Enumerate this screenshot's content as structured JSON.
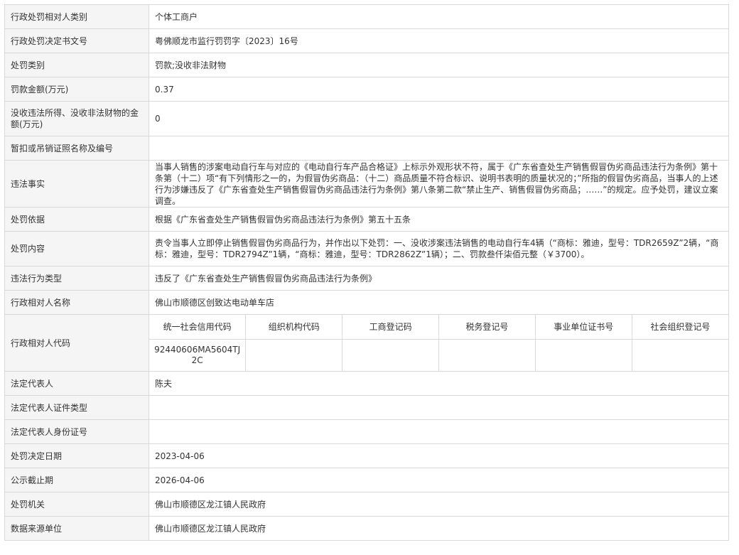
{
  "rows": [
    {
      "label": "行政处罚相对人类别",
      "value": "个体工商户"
    },
    {
      "label": "行政处罚决定书文号",
      "value": "粤佛顺龙市监行罚罚字〔2023〕16号"
    },
    {
      "label": "处罚类别",
      "value": "罚款;没收非法财物"
    },
    {
      "label": "罚款金额(万元)",
      "value": "0.37"
    },
    {
      "label": "没收违法所得、没收非法财物的金额(万元)",
      "value": "0"
    },
    {
      "label": "暂扣或吊销证照名称及编号",
      "value": ""
    },
    {
      "label": "违法事实",
      "value": "当事人销售的涉案电动自行车与对应的《电动自行车产品合格证》上标示外观形状不符，属于《广东省查处生产销售假冒伪劣商品违法行为条例》第十条第（十二）项“有下列情形之一的，为假冒伪劣商品：（十二）商品质量不符合标识、说明书表明的质量状况的；”所指的假冒伪劣商品，当事人的上述行为涉嫌违反了《广东省查处生产销售假冒伪劣商品违法行为条例》第八条第二款“禁止生产、销售假冒伪劣商品；……”的规定。应予处罚，建议立案调查。"
    },
    {
      "label": "处罚依据",
      "value": "根据《广东省查处生产销售假冒伪劣商品违法行为条例》第五十五条"
    },
    {
      "label": "处罚内容",
      "value": "责令当事人立即停止销售假冒伪劣商品行为，并作出以下处罚：一、没收涉案违法销售的电动自行车4辆（“商标：雅迪，型号：TDR2659Z”2辆，“商标：雅迪，型号：TDR2794Z”1辆，“商标：雅迪，型号：TDR2862Z”1辆）；二、罚款叁仟柒佰元整（￥3700）。"
    },
    {
      "label": "违法行为类型",
      "value": "违反了《广东省查处生产销售假冒伪劣商品违法行为条例》"
    },
    {
      "label": "行政相对人名称",
      "value": "佛山市顺德区创致达电动单车店"
    }
  ],
  "codes": {
    "label": "行政相对人代码",
    "headers": [
      "统一社会信用代码",
      "组织机构代码",
      "工商登记码",
      "税务登记号",
      "事业单位证书号",
      "社会组织登记号"
    ],
    "values": [
      "92440606MA5604TJ2C",
      "",
      "",
      "",
      "",
      ""
    ]
  },
  "rows2": [
    {
      "label": "法定代表人",
      "value": "陈夫"
    },
    {
      "label": "法定代表人证件类型",
      "value": ""
    },
    {
      "label": "法定代表人身份证号",
      "value": ""
    },
    {
      "label": "处罚决定日期",
      "value": "2023-04-06"
    },
    {
      "label": "公示截止期",
      "value": "2026-04-06"
    },
    {
      "label": "处罚机关",
      "value": "佛山市顺德区龙江镇人民政府"
    },
    {
      "label": "数据来源单位",
      "value": "佛山市顺德区龙江镇人民政府"
    }
  ]
}
